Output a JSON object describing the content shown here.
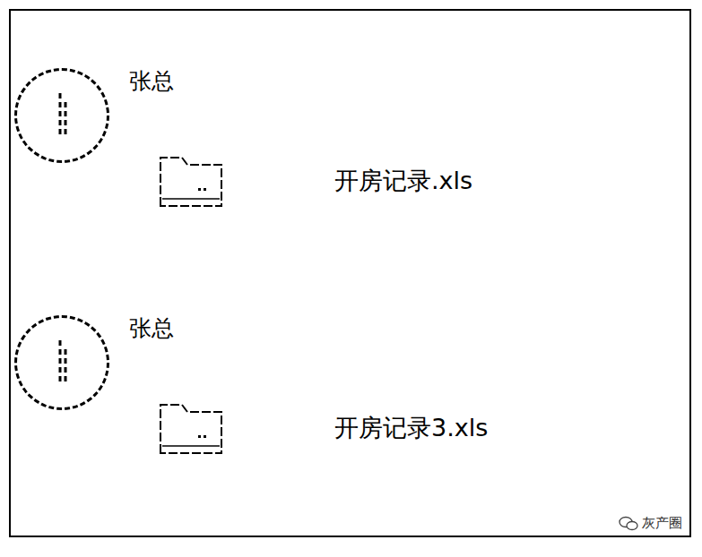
{
  "messages": [
    {
      "sender": "张总",
      "file": "开房记录.xls"
    },
    {
      "sender": "张总",
      "file": "开房记录3.xls"
    }
  ],
  "watermark": {
    "text": "灰产圈"
  }
}
